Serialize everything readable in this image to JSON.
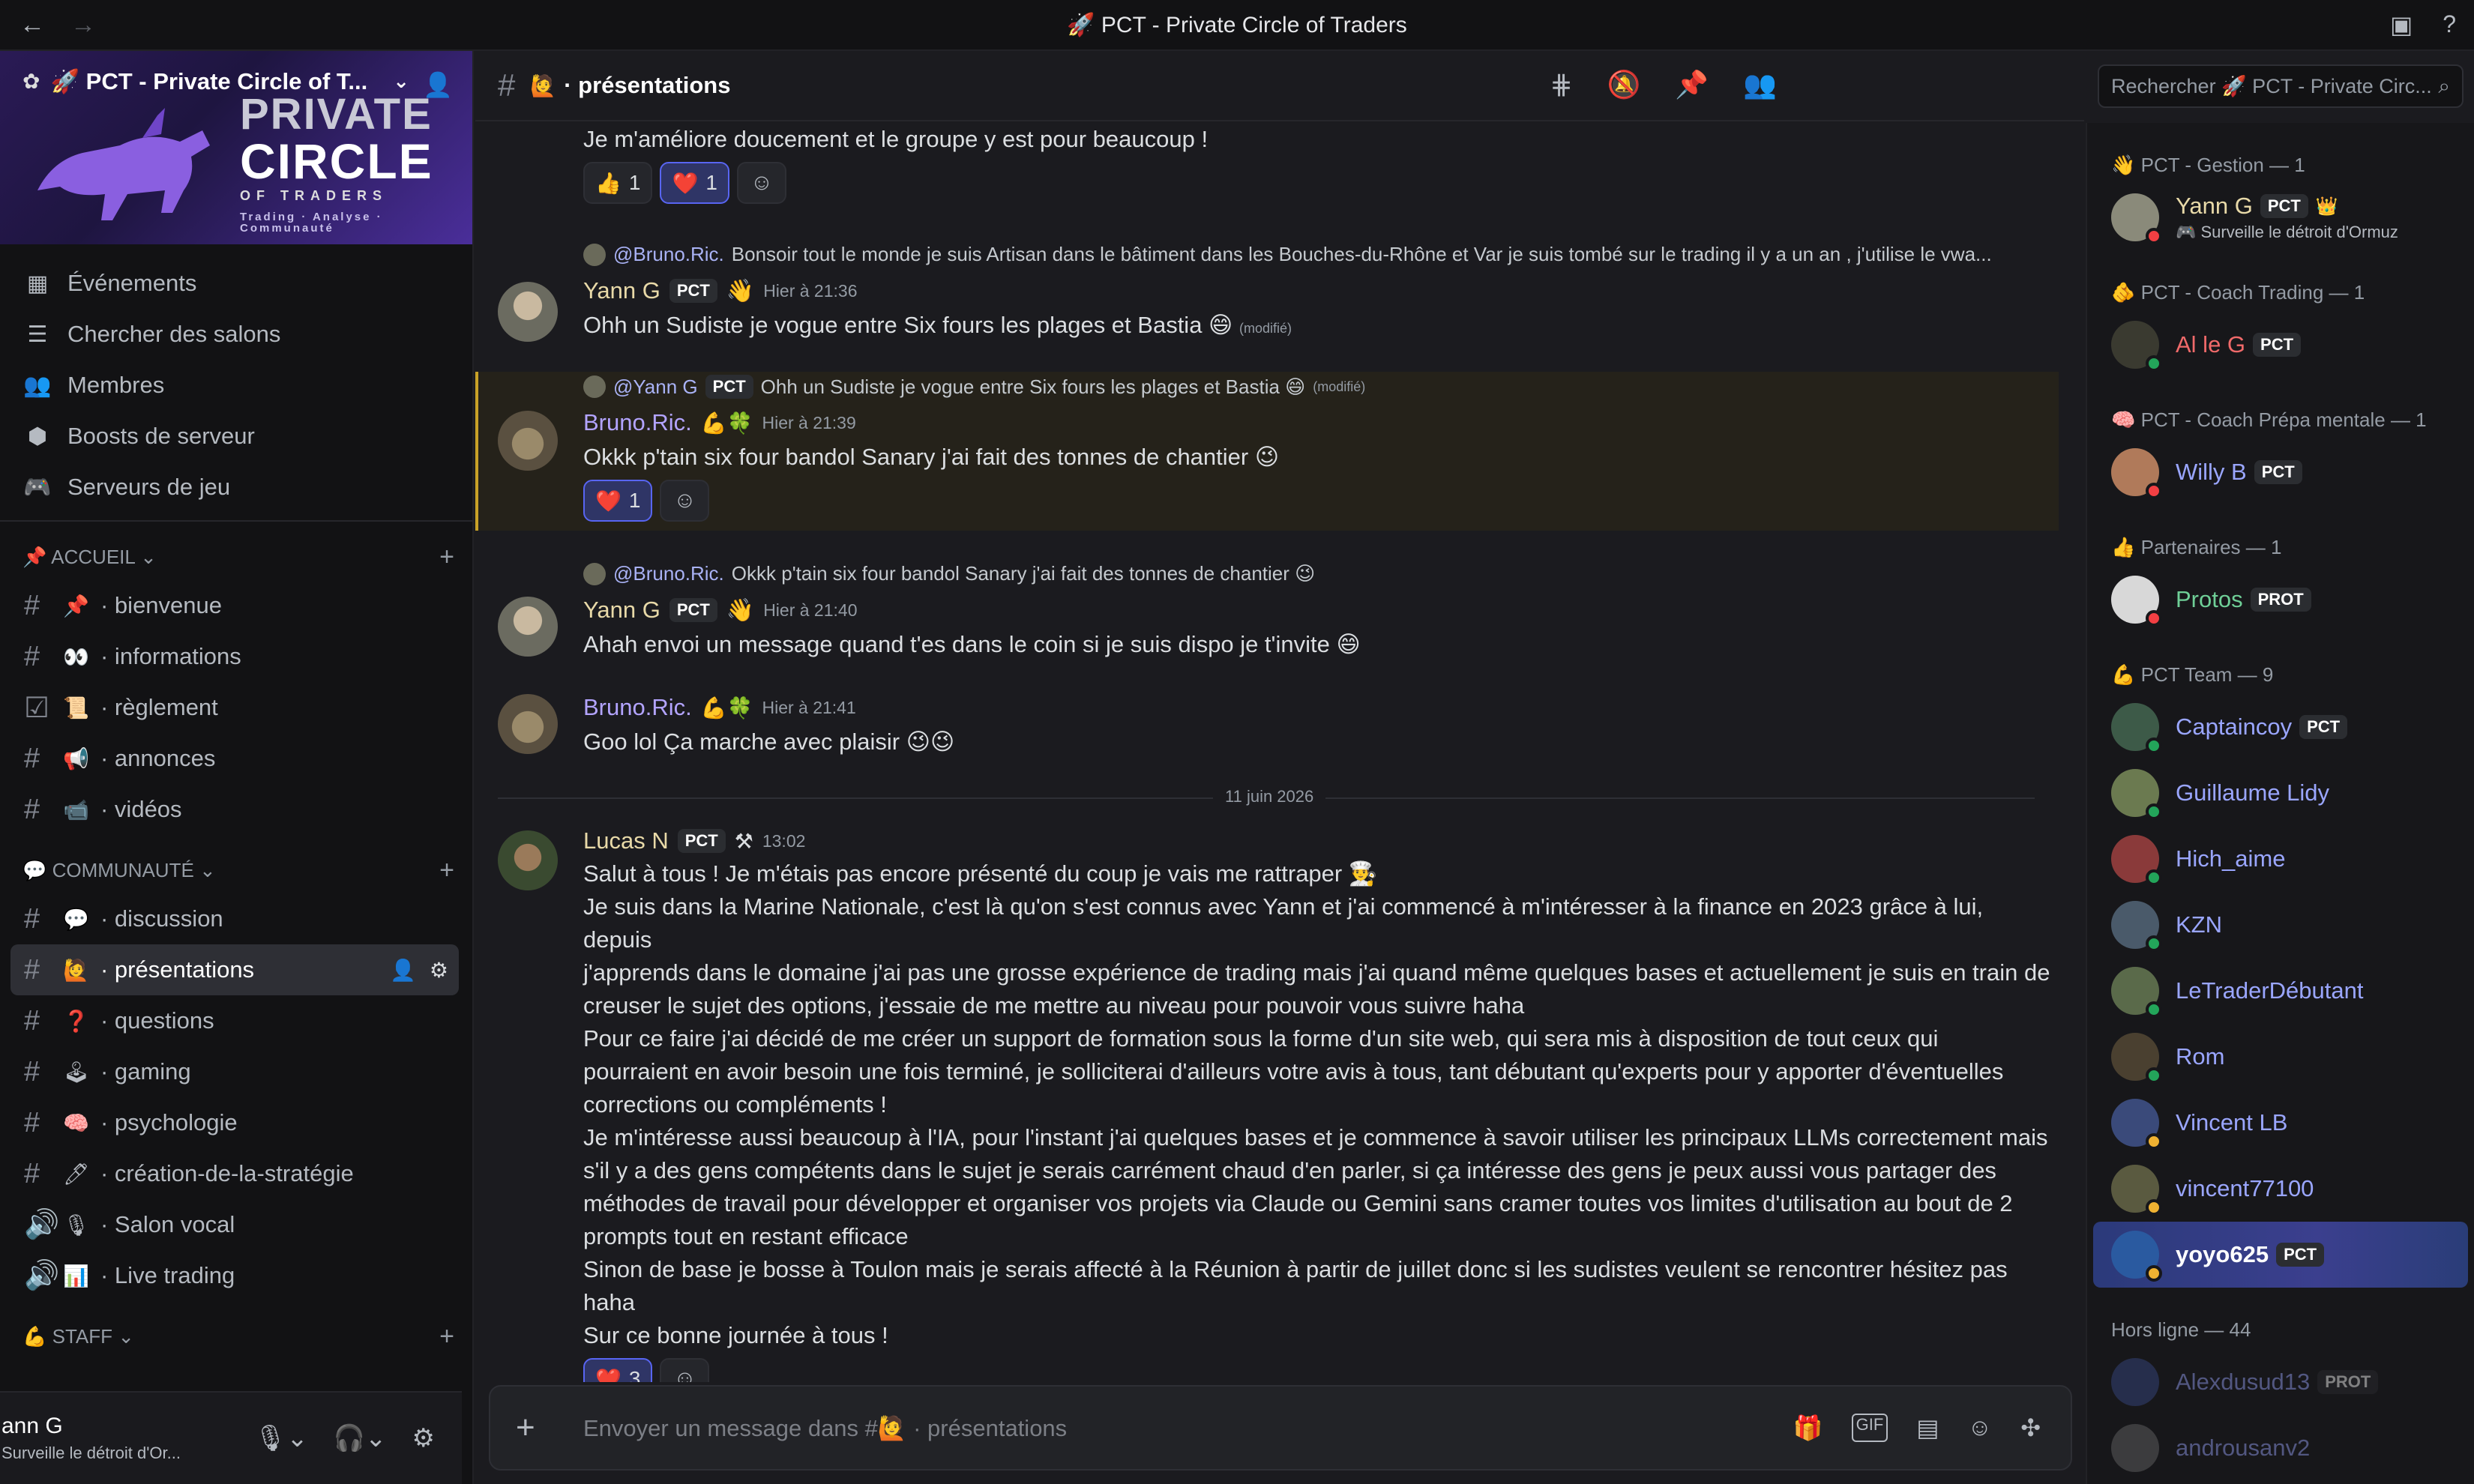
{
  "window": {
    "title": "🚀 PCT - Private Circle of Traders",
    "back": "←",
    "forward": "→",
    "right_icons": [
      "▣",
      "?"
    ]
  },
  "server": {
    "name": "🚀 PCT - Private Circle of T...",
    "brand": {
      "l1": "PRIVATE",
      "l2": "CIRCLE",
      "l3": "OF TRADERS",
      "l4": "Trading · Analyse · Communauté"
    },
    "menu": [
      {
        "icon": "calendar-icon",
        "glyph": "▦",
        "label": "Événements"
      },
      {
        "icon": "list-search-icon",
        "glyph": "☰",
        "label": "Chercher des salons"
      },
      {
        "icon": "members-icon",
        "glyph": "👥",
        "label": "Membres"
      },
      {
        "icon": "boost-icon",
        "glyph": "⬢",
        "label": "Boosts de serveur"
      },
      {
        "icon": "gamepad-icon",
        "glyph": "🎮",
        "label": "Serveurs de jeu"
      }
    ],
    "categories": [
      {
        "label": "📌 ACCUEIL ⌄",
        "channels": [
          {
            "type": "#",
            "emoji": "📌",
            "label": "· bienvenue"
          },
          {
            "type": "#",
            "emoji": "👀",
            "label": "· informations"
          },
          {
            "type": "☑",
            "emoji": "📜",
            "label": "· règlement"
          },
          {
            "type": "#",
            "emoji": "📢",
            "label": "· annonces"
          },
          {
            "type": "#",
            "emoji": "📹",
            "label": "· vidéos"
          }
        ]
      },
      {
        "label": "💬 COMMUNAUTÉ ⌄",
        "channels": [
          {
            "type": "#",
            "emoji": "💬",
            "label": "· discussion"
          },
          {
            "type": "#",
            "emoji": "🙋",
            "label": "· présentations",
            "active": true
          },
          {
            "type": "#",
            "emoji": "❓",
            "label": "· questions"
          },
          {
            "type": "#",
            "emoji": "🕹",
            "label": "· gaming"
          },
          {
            "type": "#",
            "emoji": "🧠",
            "label": "· psychologie"
          },
          {
            "type": "#",
            "emoji": "🖊",
            "label": "· création-de-la-stratégie"
          },
          {
            "type": "🔊",
            "emoji": "🎙",
            "label": "· Salon vocal"
          },
          {
            "type": "🔊",
            "emoji": "📊",
            "label": "· Live trading"
          }
        ]
      },
      {
        "label": "💪 STAFF ⌄",
        "channels": []
      }
    ],
    "user": {
      "name": "ann G",
      "status": "Surveille le détroit d'Or..."
    }
  },
  "header": {
    "channel_emoji": "🙋",
    "channel": "· présentations",
    "search_placeholder": "Rechercher 🚀 PCT - Private Circ..."
  },
  "messages": {
    "top_text": "Je m'améliore doucement et le groupe y est pour beaucoup !",
    "top_reactions": [
      {
        "emoji": "👍",
        "count": "1"
      },
      {
        "emoji": "❤️",
        "count": "1"
      }
    ],
    "m1_reply_mention": "@Bruno.Ric.",
    "m1_reply_text": "Bonsoir tout le monde je suis Artisan dans le bâtiment dans les Bouches-du-Rhône et Var je suis tombé sur le trading il y a un an , j'utilise le vwa...",
    "m1_user": "Yann G",
    "m1_tag": "PCT",
    "m1_time": "Hier à 21:36",
    "m1_text": "Ohh un Sudiste je vogue entre Six fours les plages et Bastia 😄",
    "m1_edited": "(modifié)",
    "m2_reply_mention": "@Yann G",
    "m2_reply_tag": "PCT",
    "m2_reply_text": "Ohh un Sudiste je vogue entre Six fours les plages et Bastia 😄",
    "m2_reply_edited": "(modifié)",
    "m2_user": "Bruno.Ric.",
    "m2_time": "Hier à 21:39",
    "m2_text": "Okkk p'tain six four bandol Sanary j'ai fait des tonnes de chantier 😉",
    "m2_reaction": "1",
    "m3_reply_mention": "@Bruno.Ric.",
    "m3_reply_text": "Okkk p'tain six four bandol Sanary j'ai fait des tonnes de chantier 😉",
    "m3_user": "Yann G",
    "m3_tag": "PCT",
    "m3_time": "Hier à 21:40",
    "m3_text": "Ahah envoi un message quand t'es dans le coin si je suis dispo je t'invite 😄",
    "m4_user": "Bruno.Ric.",
    "m4_time": "Hier à 21:41",
    "m4_text": "Goo lol Ça marche avec plaisir 😉😉",
    "date_divider": "11 juin 2026",
    "m5_user": "Lucas N",
    "m5_tag": "PCT",
    "m5_time": "13:02",
    "m5_lines": [
      "Salut à tous ! Je m'étais pas encore présenté du coup je vais me rattraper 👨‍🍳",
      "Je suis dans la Marine Nationale, c'est là qu'on s'est connus avec Yann et j'ai commencé à m'intéresser à la finance en 2023 grâce à lui, depuis",
      "j'apprends dans le domaine j'ai pas une grosse expérience de trading mais j'ai quand même quelques bases et actuellement je suis en train de",
      "creuser le sujet des options, j'essaie de me mettre au niveau pour pouvoir vous suivre haha",
      "Pour ce faire j'ai décidé de me créer un support de formation sous la forme d'un site web, qui sera mis à disposition de tout ceux qui",
      "pourraient en avoir besoin une fois terminé, je solliciterai d'ailleurs votre avis à tous, tant débutant qu'experts pour y apporter d'éventuelles",
      "corrections ou compléments !",
      "Je m'intéresse aussi beaucoup à l'IA, pour l'instant j'ai quelques bases et je commence à savoir utiliser les principaux LLMs correctement mais",
      "s'il y a des gens compétents dans le sujet je serais carrément chaud d'en parler, si ça intéresse des gens je peux aussi vous partager des",
      "méthodes de travail pour développer et organiser vos projets via Claude ou Gemini sans cramer toutes vos limites d'utilisation au bout de 2",
      "prompts tout en restant efficace",
      "Sinon de base je bosse à Toulon mais je serais affecté à la Réunion à partir de juillet donc si les sudistes veulent se rencontrer hésitez pas haha",
      "Sur ce bonne journée à tous !"
    ],
    "m5_reaction": "3"
  },
  "composer": {
    "placeholder": "Envoyer un message dans #🙋 · présentations",
    "plus": "+"
  },
  "members": {
    "groups": [
      {
        "label": "👋 PCT - Gestion — 1",
        "items": [
          {
            "name": "Yann G",
            "tag": "PCT",
            "badge": "👑",
            "status": "🎮 Surveille le détroit d'Ormuz",
            "color": "#e8d9a8",
            "av": "#8a8a7a",
            "dot": "#f23f43"
          }
        ]
      },
      {
        "label": "🫵 PCT - Coach Trading — 1",
        "items": [
          {
            "name": "Al le G",
            "tag": "PCT",
            "color": "#f06a6a",
            "av": "#3a3a30",
            "dot": "#23a55a"
          }
        ]
      },
      {
        "label": "🧠 PCT - Coach Prépa mentale — 1",
        "items": [
          {
            "name": "Willy B",
            "tag": "PCT",
            "color": "#9aa6ff",
            "av": "#b07a5a",
            "dot": "#f23f43"
          }
        ]
      },
      {
        "label": "👍 Partenaires — 1",
        "items": [
          {
            "name": "Protos",
            "tag": "PROT",
            "color": "#6fcf97",
            "av": "#d8d8d8",
            "dot": "#f23f43"
          }
        ]
      },
      {
        "label": "💪 PCT Team — 9",
        "items": [
          {
            "name": "Captaincoy",
            "tag": "PCT",
            "color": "#9aa6ff",
            "av": "#3d5a48",
            "dot": "#23a55a"
          },
          {
            "name": "Guillaume Lidy",
            "color": "#9aa6ff",
            "av": "#6b7a50",
            "dot": "#23a55a"
          },
          {
            "name": "Hich_aime",
            "color": "#9aa6ff",
            "av": "#8a3a3a",
            "dot": "#23a55a"
          },
          {
            "name": "KZN",
            "color": "#9aa6ff",
            "av": "#4a5a6a",
            "dot": "#23a55a"
          },
          {
            "name": "LeTraderDébutant",
            "color": "#9aa6ff",
            "av": "#5a6a4a",
            "dot": "#23a55a"
          },
          {
            "name": "Rom",
            "color": "#9aa6ff",
            "av": "#4a4030",
            "dot": "#23a55a"
          },
          {
            "name": "Vincent LB",
            "color": "#9aa6ff",
            "av": "#3a4a7a",
            "dot": "#f0b232"
          },
          {
            "name": "vincent77100",
            "color": "#9aa6ff",
            "av": "#5a5a40",
            "dot": "#f0b232"
          },
          {
            "name": "yoyo625",
            "tag": "PCT",
            "color": "#ffffff",
            "av": "#2a5aa0",
            "dot": "#f0b232",
            "hl": true
          }
        ]
      },
      {
        "label": "Hors ligne — 44",
        "offline": true,
        "items": [
          {
            "name": "Alexdusud13",
            "tag": "PROT",
            "color": "#9aa6ff",
            "av": "#3a4a8a",
            "dot": ""
          },
          {
            "name": "androusanv2",
            "color": "#9aa6ff",
            "av": "#6a6a6a",
            "dot": ""
          }
        ]
      }
    ]
  }
}
